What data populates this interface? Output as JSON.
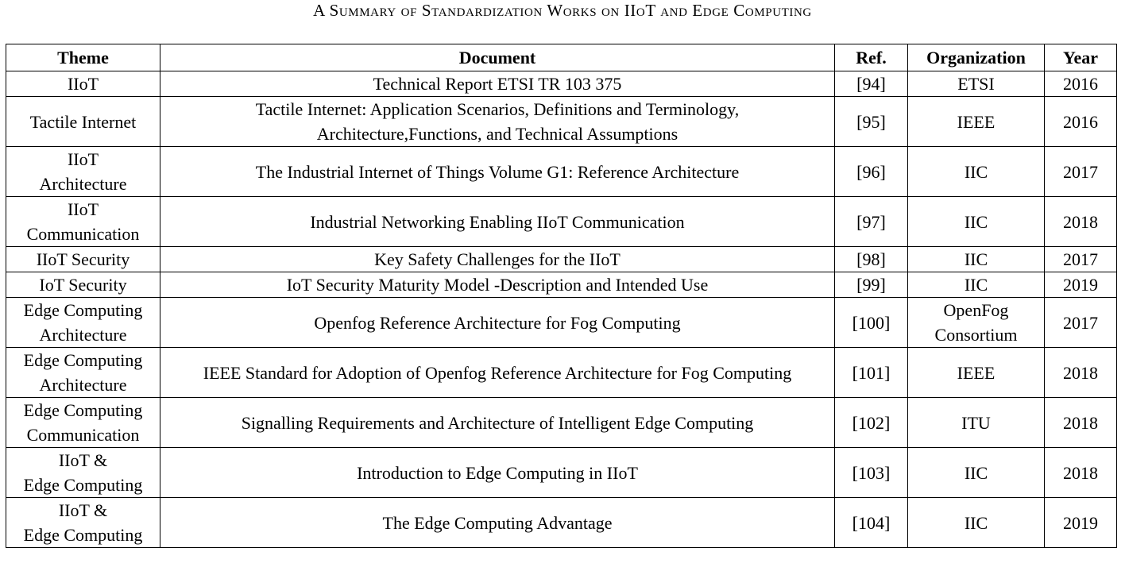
{
  "caption": "A Summary of Standardization Works on IIoT and Edge Computing",
  "headers": {
    "theme": "Theme",
    "document": "Document",
    "ref": "Ref.",
    "organization": "Organization",
    "year": "Year"
  },
  "rows": [
    {
      "theme": [
        "IIoT"
      ],
      "document": [
        "Technical Report ETSI TR 103 375"
      ],
      "ref": "[94]",
      "organization": [
        "ETSI"
      ],
      "year": "2016"
    },
    {
      "theme": [
        "Tactile Internet"
      ],
      "document": [
        "Tactile Internet: Application Scenarios, Definitions and Terminology,",
        "Architecture,Functions, and Technical Assumptions"
      ],
      "ref": "[95]",
      "organization": [
        "IEEE"
      ],
      "year": "2016"
    },
    {
      "theme": [
        "IIoT",
        "Architecture"
      ],
      "document": [
        "The Industrial Internet of Things Volume G1: Reference Architecture"
      ],
      "ref": "[96]",
      "organization": [
        "IIC"
      ],
      "year": "2017"
    },
    {
      "theme": [
        "IIoT",
        "Communication"
      ],
      "document": [
        "Industrial Networking Enabling IIoT Communication"
      ],
      "ref": "[97]",
      "organization": [
        "IIC"
      ],
      "year": "2018"
    },
    {
      "theme": [
        "IIoT Security"
      ],
      "document": [
        "Key Safety Challenges for the IIoT"
      ],
      "ref": "[98]",
      "organization": [
        "IIC"
      ],
      "year": "2017"
    },
    {
      "theme": [
        "IoT Security"
      ],
      "document": [
        "IoT Security Maturity Model -Description and Intended Use"
      ],
      "ref": "[99]",
      "organization": [
        "IIC"
      ],
      "year": "2019"
    },
    {
      "theme": [
        "Edge Computing",
        "Architecture"
      ],
      "document": [
        "Openfog Reference Architecture for Fog Computing"
      ],
      "ref": "[100]",
      "organization": [
        "OpenFog",
        "Consortium"
      ],
      "year": "2017"
    },
    {
      "theme": [
        "Edge Computing",
        "Architecture"
      ],
      "document": [
        "IEEE Standard for Adoption of Openfog Reference Architecture for Fog Computing"
      ],
      "ref": "[101]",
      "organization": [
        "IEEE"
      ],
      "year": "2018"
    },
    {
      "theme": [
        "Edge Computing",
        "Communication"
      ],
      "document": [
        "Signalling Requirements and Architecture of Intelligent Edge Computing"
      ],
      "ref": "[102]",
      "organization": [
        "ITU"
      ],
      "year": "2018"
    },
    {
      "theme": [
        "IIoT &",
        "Edge Computing"
      ],
      "document": [
        "Introduction to Edge Computing in IIoT"
      ],
      "ref": "[103]",
      "organization": [
        "IIC"
      ],
      "year": "2018"
    },
    {
      "theme": [
        "IIoT &",
        "Edge Computing"
      ],
      "document": [
        "The Edge Computing Advantage"
      ],
      "ref": "[104]",
      "organization": [
        "IIC"
      ],
      "year": "2019"
    }
  ]
}
